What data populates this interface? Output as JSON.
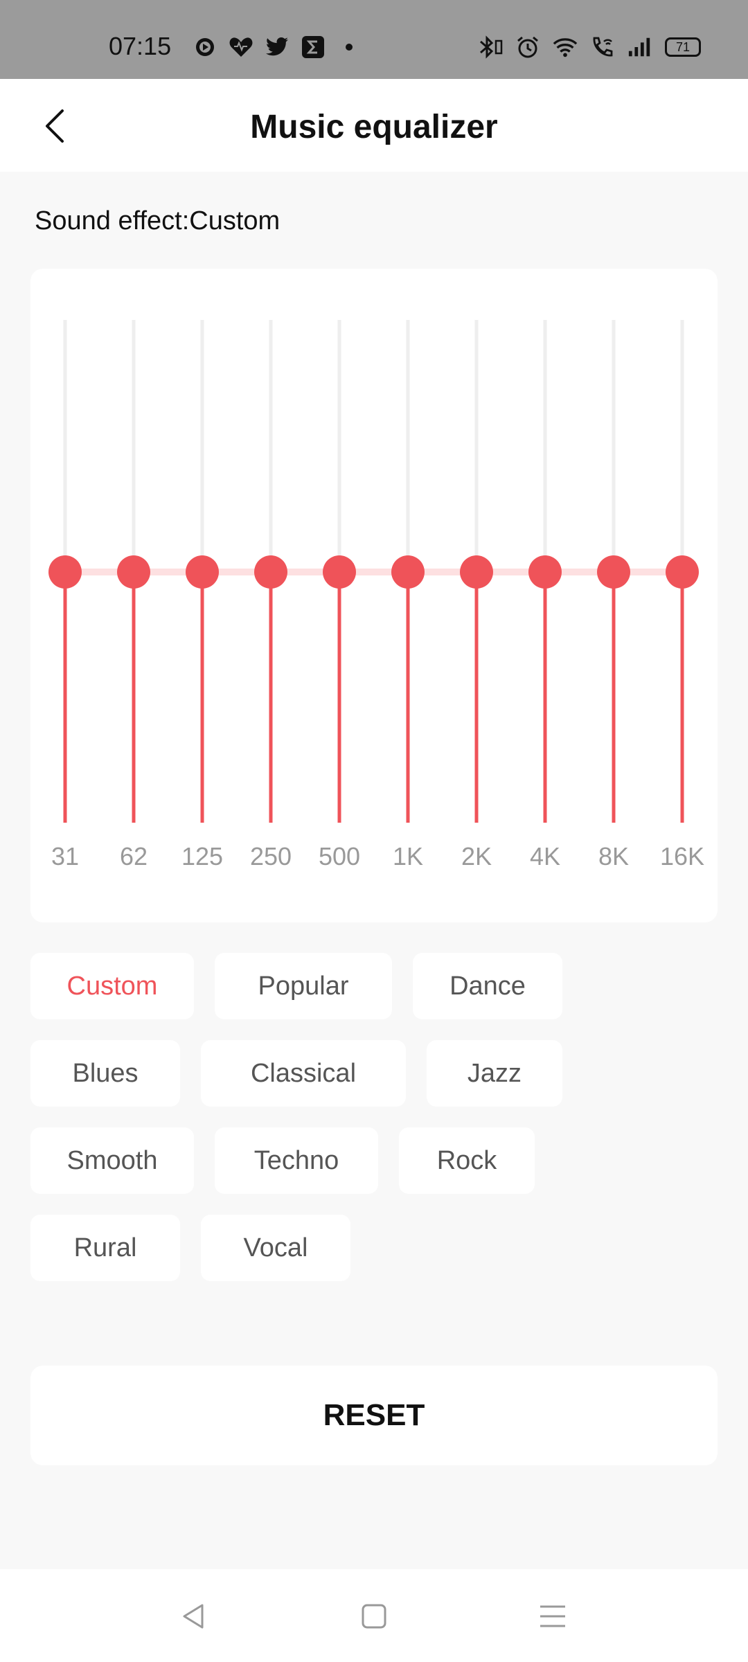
{
  "status_bar": {
    "time": "07:15",
    "left_icons": [
      "media-play-icon",
      "heart-icon",
      "twitter-icon",
      "sigma-app-icon",
      "dot-icon"
    ],
    "right_icons": [
      "bluetooth-icon",
      "alarm-icon",
      "wifi-icon",
      "wifi-call-icon",
      "signal-icon"
    ],
    "battery_level": "71"
  },
  "header": {
    "title": "Music equalizer"
  },
  "sound_effect": {
    "text": "Sound effect:Custom"
  },
  "equalizer": {
    "accent_color": "#ef5359",
    "track_color": "#eeeeee",
    "bands": [
      {
        "label": "31",
        "level": 0
      },
      {
        "label": "62",
        "level": 0
      },
      {
        "label": "125",
        "level": 0
      },
      {
        "label": "250",
        "level": 0
      },
      {
        "label": "500",
        "level": 0
      },
      {
        "label": "1K",
        "level": 0
      },
      {
        "label": "2K",
        "level": 0
      },
      {
        "label": "4K",
        "level": 0
      },
      {
        "label": "8K",
        "level": 0
      },
      {
        "label": "16K",
        "level": 0
      }
    ]
  },
  "presets": [
    [
      "Custom",
      "Popular",
      "Dance"
    ],
    [
      "Blues",
      "Classical",
      "Jazz"
    ],
    [
      "Smooth",
      "Techno",
      "Rock"
    ],
    [
      "Rural",
      "Vocal"
    ]
  ],
  "active_preset": "Custom",
  "reset_label": "RESET",
  "nav": [
    "back-icon",
    "home-icon",
    "menu-icon"
  ]
}
